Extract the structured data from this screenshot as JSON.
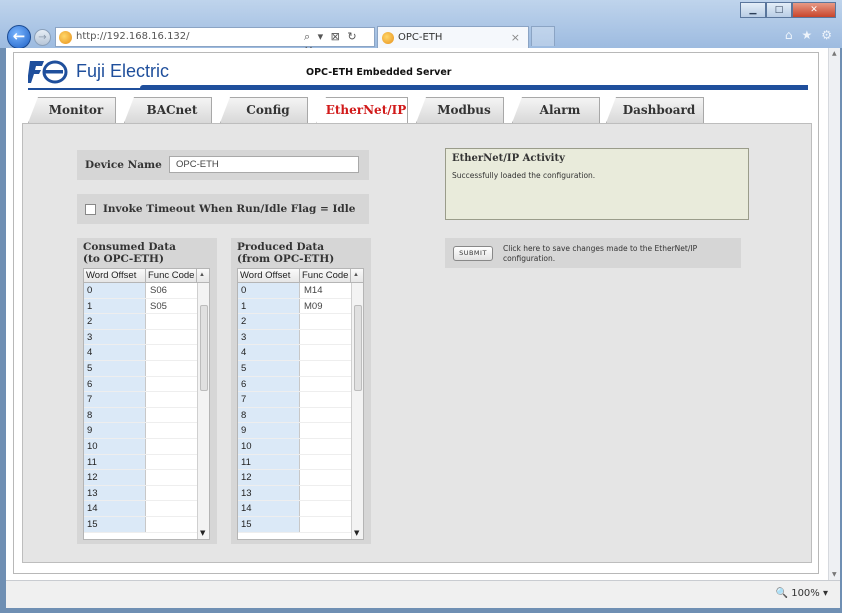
{
  "browser": {
    "url": "http://192.168.16.132/",
    "tab_title": "OPC-ETH",
    "zoom": "100%"
  },
  "header": {
    "brand": "Fuji Electric",
    "server_title": "OPC-ETH Embedded Server"
  },
  "tabs": [
    {
      "label": "Monitor",
      "active": false
    },
    {
      "label": "BACnet",
      "active": false
    },
    {
      "label": "Config",
      "active": false
    },
    {
      "label": "EtherNet/IP",
      "active": true
    },
    {
      "label": "Modbus",
      "active": false
    },
    {
      "label": "Alarm",
      "active": false
    },
    {
      "label": "Dashboard",
      "active": false
    }
  ],
  "device": {
    "label": "Device Name",
    "value": "OPC-ETH"
  },
  "invoke_timeout": {
    "label": "Invoke Timeout When Run/Idle Flag = Idle",
    "checked": false
  },
  "consumed": {
    "title_line1": "Consumed Data",
    "title_line2": "(to OPC-ETH)",
    "col_offset": "Word Offset",
    "col_func": "Func Code",
    "rows": [
      {
        "offset": "0",
        "func": "S06"
      },
      {
        "offset": "1",
        "func": "S05"
      },
      {
        "offset": "2",
        "func": ""
      },
      {
        "offset": "3",
        "func": ""
      },
      {
        "offset": "4",
        "func": ""
      },
      {
        "offset": "5",
        "func": ""
      },
      {
        "offset": "6",
        "func": ""
      },
      {
        "offset": "7",
        "func": ""
      },
      {
        "offset": "8",
        "func": ""
      },
      {
        "offset": "9",
        "func": ""
      },
      {
        "offset": "10",
        "func": ""
      },
      {
        "offset": "11",
        "func": ""
      },
      {
        "offset": "12",
        "func": ""
      },
      {
        "offset": "13",
        "func": ""
      },
      {
        "offset": "14",
        "func": ""
      },
      {
        "offset": "15",
        "func": ""
      }
    ]
  },
  "produced": {
    "title_line1": "Produced Data",
    "title_line2": "(from OPC-ETH)",
    "col_offset": "Word Offset",
    "col_func": "Func Code",
    "rows": [
      {
        "offset": "0",
        "func": "M14"
      },
      {
        "offset": "1",
        "func": "M09"
      },
      {
        "offset": "2",
        "func": ""
      },
      {
        "offset": "3",
        "func": ""
      },
      {
        "offset": "4",
        "func": ""
      },
      {
        "offset": "5",
        "func": ""
      },
      {
        "offset": "6",
        "func": ""
      },
      {
        "offset": "7",
        "func": ""
      },
      {
        "offset": "8",
        "func": ""
      },
      {
        "offset": "9",
        "func": ""
      },
      {
        "offset": "10",
        "func": ""
      },
      {
        "offset": "11",
        "func": ""
      },
      {
        "offset": "12",
        "func": ""
      },
      {
        "offset": "13",
        "func": ""
      },
      {
        "offset": "14",
        "func": ""
      },
      {
        "offset": "15",
        "func": ""
      }
    ]
  },
  "activity": {
    "title": "EtherNet/IP Activity",
    "message": "Successfully loaded the configuration."
  },
  "submit": {
    "button_label": "SUBMIT",
    "description": "Click here to save changes made to the EtherNet/IP configuration."
  },
  "colors": {
    "brand_blue": "#1f4f9c",
    "active_tab_text": "#d11a1a",
    "offset_column_bg": "#dbe9f7"
  }
}
